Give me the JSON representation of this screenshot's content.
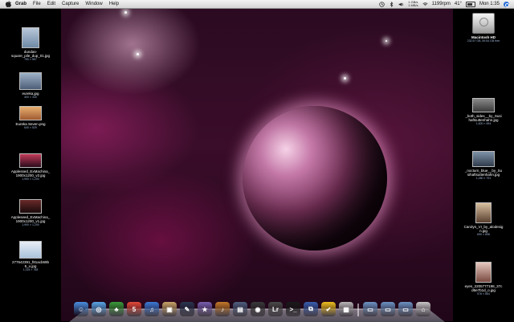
{
  "menubar": {
    "app_name": "Grab",
    "menus": [
      "File",
      "Edit",
      "Capture",
      "Window",
      "Help"
    ],
    "stats_line1": "1 GB/s",
    "stats_line2": "1 MB/s",
    "fan": "1199rpm",
    "temp": "41°",
    "clock": "Mon 1:35"
  },
  "desktop": {
    "left_icons": [
      {
        "label": "dundas-\nsquare_pile_dup_01.jpg",
        "meta": "750 × 557"
      },
      {
        "label": "eureka.jpg",
        "meta": "400 × 330"
      },
      {
        "label": "Eureka Seven.png",
        "meta": "640 × 525"
      },
      {
        "label": "Applessed_ExMachina_\n1900x1200_v2.jpg",
        "meta": "1,900 × 1,200"
      },
      {
        "label": "Appleseed_ExMachina_\n1900x1200_v1.jpg",
        "meta": "1,900 × 1,200"
      },
      {
        "label": "277642391_f81acb59b\n5_o.jpg",
        "meta": "1,024 × 768"
      }
    ],
    "right_icons": [
      {
        "label": "Macintosh HD",
        "meta": "232.57 GB, 59.54 GB free"
      },
      {
        "label": "_both_sides__by_Susi\nhaftsuttenhahn.jpg",
        "meta": "1,600 × 694"
      },
      {
        "label": "_nocturn_blue__by_Su\nsihaftsuttenhahn.jpg",
        "meta": "1,280 × 791"
      },
      {
        "label": "Carolyn_VI_by_alodesig\nn.jpg",
        "meta": "690 × 898"
      },
      {
        "label": "eyes_2205777198_37c\nd6e7b1d_o.jpg",
        "meta": "576 × 864"
      }
    ]
  },
  "dock": {
    "items": [
      {
        "name": "finder-icon",
        "color": "#4a8fe0",
        "glyph": "☺"
      },
      {
        "name": "safari-icon",
        "color": "#5aa7e8",
        "glyph": "◎"
      },
      {
        "name": "adium-icon",
        "color": "#3a9c3a",
        "glyph": "♣"
      },
      {
        "name": "ical-icon",
        "color": "#e24a3a",
        "glyph": "5"
      },
      {
        "name": "itunes-icon",
        "color": "#3c7ad6",
        "glyph": "♫"
      },
      {
        "name": "iphoto-icon",
        "color": "#c9a56a",
        "glyph": "▣"
      },
      {
        "name": "photoshop-icon",
        "color": "#2a3550",
        "glyph": "✎"
      },
      {
        "name": "imovie-icon",
        "color": "#7a5fb0",
        "glyph": "★"
      },
      {
        "name": "garageband-icon",
        "color": "#c47a2a",
        "glyph": "♪"
      },
      {
        "name": "expose-icon",
        "color": "#4f5f80",
        "glyph": "▤"
      },
      {
        "name": "photo-booth-icon",
        "color": "#3a3a3a",
        "glyph": "◉"
      },
      {
        "name": "lightroom-icon",
        "color": "#4a4a4a",
        "glyph": "Lr"
      },
      {
        "name": "terminal-icon",
        "color": "#1a1a1a",
        "glyph": ">_"
      },
      {
        "name": "remote-desktop-icon",
        "color": "#3a5fb0",
        "glyph": "⧉"
      },
      {
        "name": "things-icon",
        "color": "#f0c020",
        "glyph": "✔"
      },
      {
        "name": "preview-icon",
        "color": "#b8b8b8",
        "glyph": "▦"
      }
    ],
    "right_items": [
      {
        "name": "applications-folder-icon",
        "color": "#6d94c4",
        "glyph": "▭"
      },
      {
        "name": "documents-folder-icon",
        "color": "#6d94c4",
        "glyph": "▭"
      },
      {
        "name": "downloads-folder-icon",
        "color": "#6d94c4",
        "glyph": "▭"
      },
      {
        "name": "trash-icon",
        "color": "#c8c8c8",
        "glyph": "⌂"
      }
    ]
  }
}
